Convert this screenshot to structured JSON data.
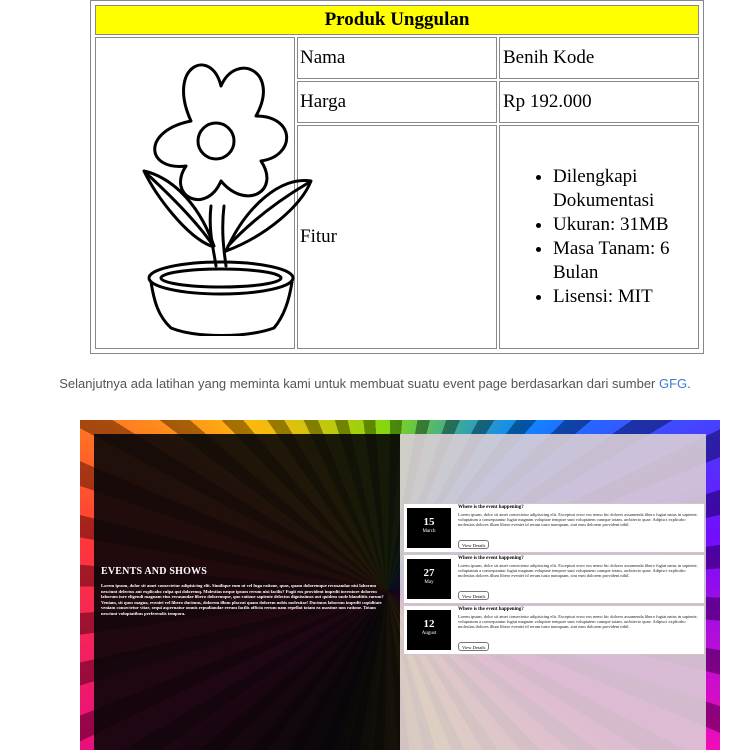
{
  "product": {
    "title": "Produk Unggulan",
    "rows": [
      {
        "label": "Nama",
        "value": "Benih Kode"
      },
      {
        "label": "Harga",
        "value": "Rp 192.000"
      },
      {
        "label": "Fitur"
      }
    ],
    "features": [
      "Dilengkapi Dokumentasi",
      "Ukuran: 31MB",
      "Masa Tanam: 6 Bulan",
      "Lisensi: MIT"
    ]
  },
  "paragraph": {
    "text": "Selanjutnya ada latihan yang meminta kami untuk membuat suatu event page berdasarkan dari sumber ",
    "link": "GFG",
    "end": "."
  },
  "event_page": {
    "heading": "EVENTS AND SHOWS",
    "body": "Lorem ipsum, dolor sit amet consectetur adipisicing elit. Similique eum ut vel fuga ratione, quas, quam doloremque recusandae nisi laborum nesciunt delectus aut explicabo culpa qui doloremq. Molestias neque ipsum rerum nisi facilis? Fugit eos provident impedit inventore dolorem laborum iure eligendi magnam eius recusandae libero doloremque, quo ratione sapiente delectus dignissimos aut quidem unde blanditiis earum? Veniam, sit quos magna, eveniet vel libero ducimus, dolorem illum placeat quam dolorem nobis molestiae! Ducimus laborum impedit cupiditate veniam consectetur vitae, sequi aspernatur omnis repudiandae rerum facilis officia rerum nam repellat totam ea maxime non ratione. Totam nesciunt voluptatibus perferendis tempora.",
    "events": [
      {
        "day": "15",
        "month": "March",
        "title": "Where is the event happening?",
        "text": "Lorem ipsum, dolor sit amet consectetur adipisicing elit. Excepturi error eos nemo hic dolores assumenda libero fugiat natus in sapiente, voluptatum a consequuntur fugiat magnam voluptate tempore sunt voluptatem cumque totam, architecto quae. Adipisci explicabo molestias dolores illum libero eveniet id rerum iusto numquam, sint eum dolorem provident nihil.",
        "button": "View Details"
      },
      {
        "day": "27",
        "month": "May",
        "title": "Where is the event happening?",
        "text": "Lorem ipsum, dolor sit amet consectetur adipisicing elit. Excepturi error eos nemo hic dolores assumenda libero fugiat natus in sapiente, voluptatum a consequuntur fugiat magnam voluptate tempore sunt voluptatem cumque totam, architecto quae. Adipisci explicabo molestias dolores illum libero eveniet id rerum iusto numquam, sint eum dolorem provident nihil.",
        "button": "View Details"
      },
      {
        "day": "12",
        "month": "August",
        "title": "Where is the event happening?",
        "text": "Lorem ipsum, dolor sit amet consectetur adipisicing elit. Excepturi error eos nemo hic dolores assumenda libero fugiat natus in sapiente, voluptatum a consequuntur fugiat magnam voluptate tempore sunt voluptatem cumque totam, architecto quae. Adipisci explicabo molestias dolores illum libero eveniet id rerum iusto numquam, sint eum dolorem provident nihil.",
        "button": "View Details"
      }
    ]
  }
}
